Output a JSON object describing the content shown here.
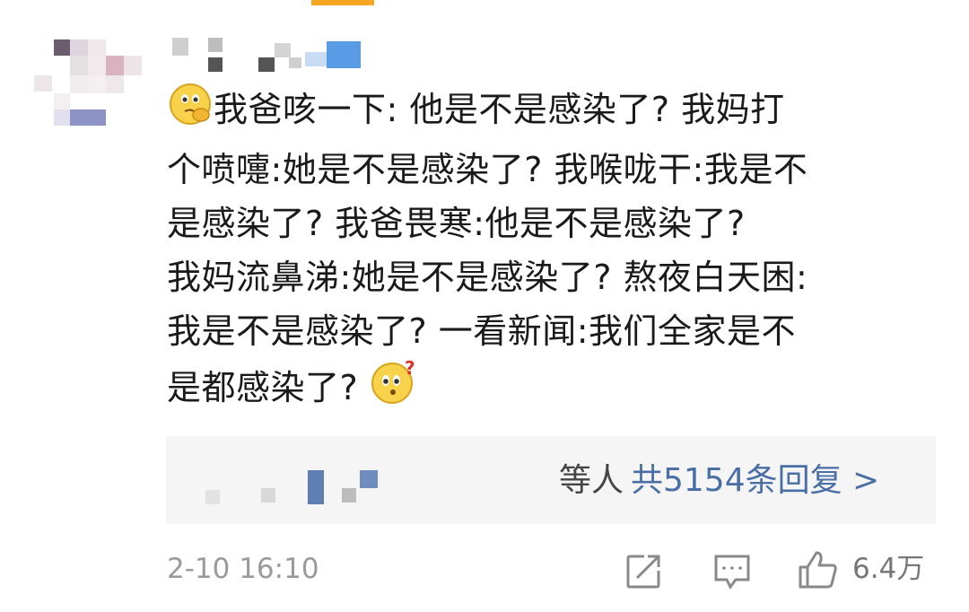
{
  "comment": {
    "lines": [
      "我爸咳一下: 他是不是感染了?    我妈打",
      "个喷嚏:她是不是感染了?   我喉咙干:我是不",
      "是感染了?    我爸畏寒:他是不是感染了?",
      "我妈流鼻涕:她是不是感染了?    熬夜白天困:",
      "我是不是感染了?     一看新闻:我们全家是不",
      "是都感染了?"
    ],
    "leading_emoji": "thinking-face-emoji",
    "trailing_emoji": "confused-question-face-emoji"
  },
  "replies": {
    "suffix": "等人",
    "link": "共5154条回复 >"
  },
  "footer": {
    "timestamp": "2-10 16:10",
    "like_count": "6.4万",
    "icons": [
      "share-icon",
      "comment-icon",
      "like-icon"
    ]
  },
  "colors": {
    "accent": "#f5a623",
    "link": "#4a6fa5",
    "muted": "#9a9a9a",
    "reply_bg": "#f5f5f5"
  }
}
